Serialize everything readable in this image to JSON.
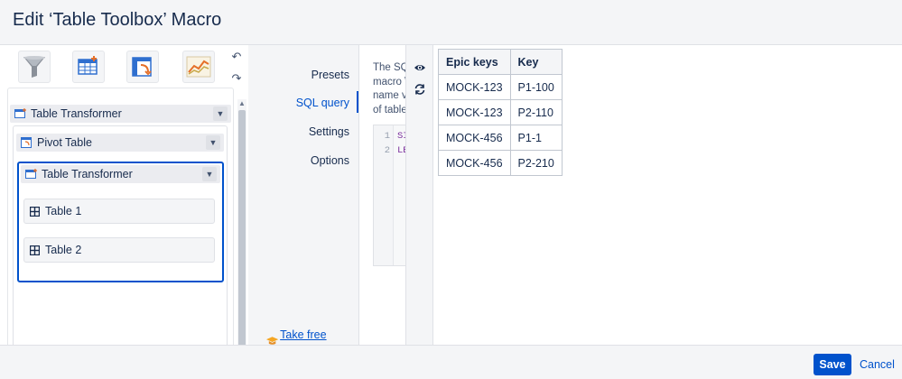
{
  "dialog": {
    "title": "Edit ‘Table Toolbox’ Macro"
  },
  "toolbar": {
    "tools": [
      {
        "icon": "funnel-icon"
      },
      {
        "icon": "table-add-icon"
      },
      {
        "icon": "pivot-table-icon"
      },
      {
        "icon": "chart-icon"
      }
    ],
    "undo_icon": "undo-icon",
    "redo_icon": "redo-icon"
  },
  "tree": {
    "root": {
      "label": "Table Transformer"
    },
    "pivot": {
      "label": "Pivot Table"
    },
    "inner": {
      "label": "Table Transformer"
    },
    "tables": [
      {
        "label": "Table 1"
      },
      {
        "label": "Table 2"
      }
    ]
  },
  "nav": {
    "items": [
      {
        "label": "Presets"
      },
      {
        "label": "SQL query",
        "active": true
      },
      {
        "label": "Settings"
      },
      {
        "label": "Options"
      }
    ],
    "course_link": "Take free course"
  },
  "content": {
    "desc_lines": [
      "The SQ",
      "macro \\",
      "name v",
      "of table"
    ],
    "editor_lines": [
      {
        "num": "1",
        "code": "SI"
      },
      {
        "num": "2",
        "code": "LE"
      }
    ]
  },
  "preview": {
    "columns": [
      "Epic keys",
      "Key"
    ],
    "rows": [
      [
        "MOCK-123",
        "P1-100"
      ],
      [
        "MOCK-123",
        "P2-110"
      ],
      [
        "MOCK-456",
        "P1-1"
      ],
      [
        "MOCK-456",
        "P2-210"
      ]
    ]
  },
  "footer": {
    "save_label": "Save",
    "cancel_label": "Cancel"
  },
  "colors": {
    "accent": "#0052cc",
    "panel": "#f4f5f7",
    "border": "#dfe1e6"
  }
}
